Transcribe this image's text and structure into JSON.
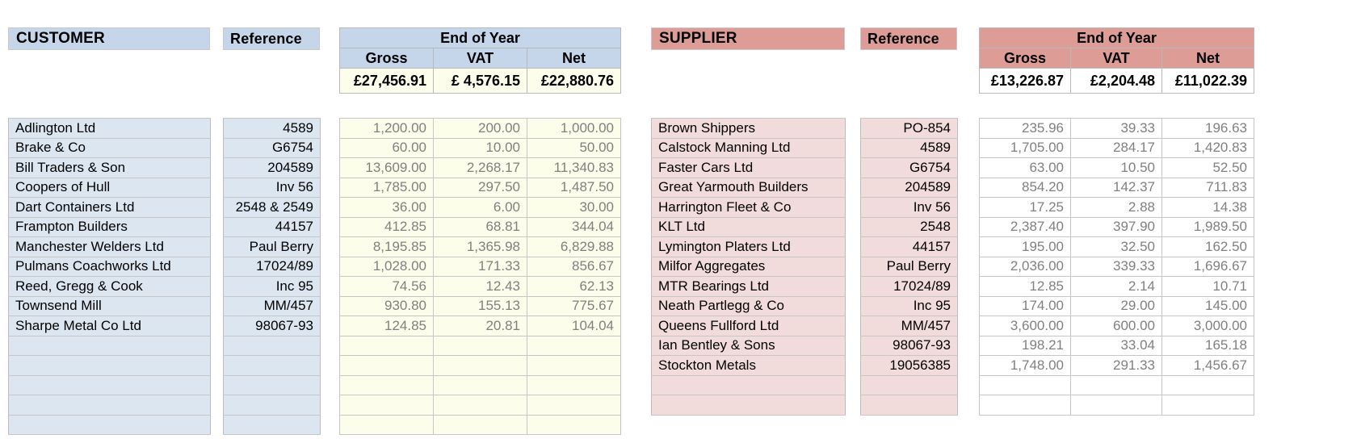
{
  "customer": {
    "title": "CUSTOMER",
    "reference_label": "Reference",
    "eoy": {
      "title": "End of Year",
      "columns": [
        "Gross",
        "VAT",
        "Net"
      ],
      "totals": [
        "£27,456.91",
        "£  4,576.15",
        "£22,880.76"
      ]
    },
    "rows": [
      {
        "name": "Adlington Ltd",
        "reference": "4589",
        "gross": "1,200.00",
        "vat": "200.00",
        "net": "1,000.00"
      },
      {
        "name": "Brake & Co",
        "reference": "G6754",
        "gross": "60.00",
        "vat": "10.00",
        "net": "50.00"
      },
      {
        "name": "Bill Traders & Son",
        "reference": "204589",
        "gross": "13,609.00",
        "vat": "2,268.17",
        "net": "11,340.83"
      },
      {
        "name": "Coopers of Hull",
        "reference": "Inv 56",
        "gross": "1,785.00",
        "vat": "297.50",
        "net": "1,487.50"
      },
      {
        "name": "Dart Containers Ltd",
        "reference": "2548 & 2549",
        "gross": "36.00",
        "vat": "6.00",
        "net": "30.00"
      },
      {
        "name": "Frampton Builders",
        "reference": "44157",
        "gross": "412.85",
        "vat": "68.81",
        "net": "344.04"
      },
      {
        "name": "Manchester Welders Ltd",
        "reference": "Paul Berry",
        "gross": "8,195.85",
        "vat": "1,365.98",
        "net": "6,829.88"
      },
      {
        "name": "Pulmans Coachworks Ltd",
        "reference": "17024/89",
        "gross": "1,028.00",
        "vat": "171.33",
        "net": "856.67"
      },
      {
        "name": "Reed, Gregg & Cook",
        "reference": "Inc 95",
        "gross": "74.56",
        "vat": "12.43",
        "net": "62.13"
      },
      {
        "name": "Townsend Mill",
        "reference": "MM/457",
        "gross": "930.80",
        "vat": "155.13",
        "net": "775.67"
      },
      {
        "name": "Sharpe Metal Co Ltd",
        "reference": "98067-93",
        "gross": "124.85",
        "vat": "20.81",
        "net": "104.04"
      },
      {
        "name": "",
        "reference": "",
        "gross": "",
        "vat": "",
        "net": ""
      },
      {
        "name": "",
        "reference": "",
        "gross": "",
        "vat": "",
        "net": ""
      },
      {
        "name": "",
        "reference": "",
        "gross": "",
        "vat": "",
        "net": ""
      },
      {
        "name": "",
        "reference": "",
        "gross": "",
        "vat": "",
        "net": ""
      },
      {
        "name": "",
        "reference": "",
        "gross": "",
        "vat": "",
        "net": ""
      }
    ]
  },
  "supplier": {
    "title": "SUPPLIER",
    "reference_label": "Reference",
    "eoy": {
      "title": "End of Year",
      "columns": [
        "Gross",
        "VAT",
        "Net"
      ],
      "totals": [
        "£13,226.87",
        "£2,204.48",
        "£11,022.39"
      ]
    },
    "rows": [
      {
        "name": "Brown Shippers",
        "reference": "PO-854",
        "gross": "235.96",
        "vat": "39.33",
        "net": "196.63"
      },
      {
        "name": "Calstock Manning Ltd",
        "reference": "4589",
        "gross": "1,705.00",
        "vat": "284.17",
        "net": "1,420.83"
      },
      {
        "name": "Faster Cars Ltd",
        "reference": "G6754",
        "gross": "63.00",
        "vat": "10.50",
        "net": "52.50"
      },
      {
        "name": "Great Yarmouth Builders",
        "reference": "204589",
        "gross": "854.20",
        "vat": "142.37",
        "net": "711.83"
      },
      {
        "name": "Harrington Fleet & Co",
        "reference": "Inv 56",
        "gross": "17.25",
        "vat": "2.88",
        "net": "14.38"
      },
      {
        "name": "KLT Ltd",
        "reference": "2548",
        "gross": "2,387.40",
        "vat": "397.90",
        "net": "1,989.50"
      },
      {
        "name": "Lymington Platers Ltd",
        "reference": "44157",
        "gross": "195.00",
        "vat": "32.50",
        "net": "162.50"
      },
      {
        "name": "Milfor Aggregates",
        "reference": "Paul Berry",
        "gross": "2,036.00",
        "vat": "339.33",
        "net": "1,696.67"
      },
      {
        "name": "MTR Bearings Ltd",
        "reference": "17024/89",
        "gross": "12.85",
        "vat": "2.14",
        "net": "10.71"
      },
      {
        "name": "Neath Partlegg & Co",
        "reference": "Inc 95",
        "gross": "174.00",
        "vat": "29.00",
        "net": "145.00"
      },
      {
        "name": "Queens Fullford Ltd",
        "reference": "MM/457",
        "gross": "3,600.00",
        "vat": "600.00",
        "net": "3,000.00"
      },
      {
        "name": "Ian Bentley & Sons",
        "reference": "98067-93",
        "gross": "198.21",
        "vat": "33.04",
        "net": "165.18"
      },
      {
        "name": "Stockton Metals",
        "reference": "19056385",
        "gross": "1,748.00",
        "vat": "291.33",
        "net": "1,456.67"
      },
      {
        "name": "",
        "reference": "",
        "gross": "",
        "vat": "",
        "net": ""
      },
      {
        "name": "",
        "reference": "",
        "gross": "",
        "vat": "",
        "net": ""
      }
    ]
  },
  "colors": {
    "customer_header": "#c5d6ea",
    "customer_band": "#dce6f1",
    "customer_numbers": "#fdfdeb",
    "supplier_header": "#dd9c96",
    "supplier_band": "#f2dcdb",
    "supplier_numbers": "#ffffff",
    "number_text": "#808080",
    "grid_line": "#c6c6c6"
  }
}
